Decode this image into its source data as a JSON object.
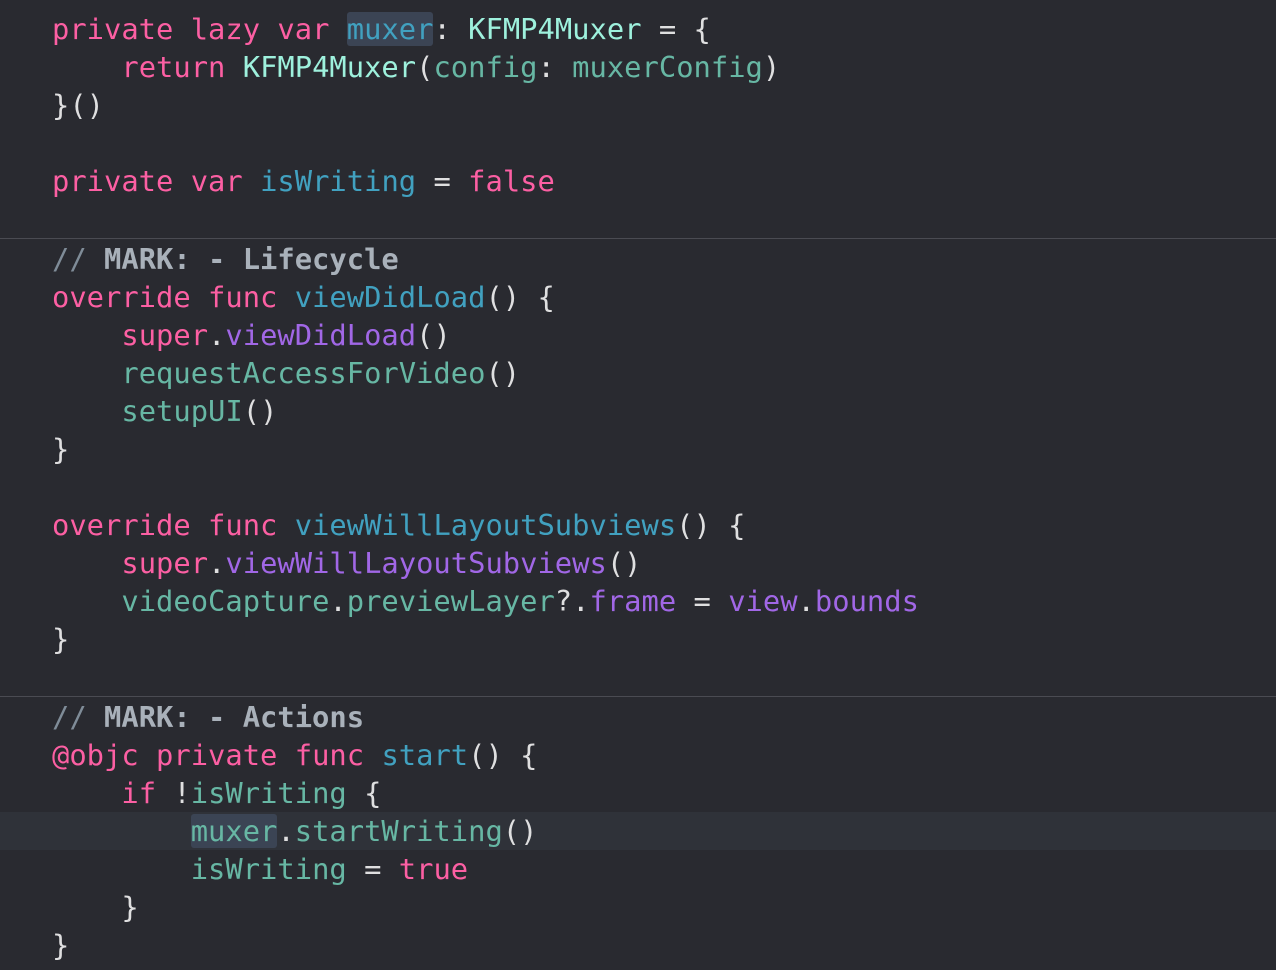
{
  "editor": {
    "lines": [
      {
        "t": 10,
        "tokens": [
          {
            "text": "private",
            "c": "kw"
          },
          {
            "text": " ",
            "c": "plain"
          },
          {
            "text": "lazy",
            "c": "kw"
          },
          {
            "text": " ",
            "c": "plain"
          },
          {
            "text": "var",
            "c": "kw"
          },
          {
            "text": " ",
            "c": "plain"
          },
          {
            "text": "muxer",
            "c": "decl",
            "hl": true
          },
          {
            "text": ": ",
            "c": "plain"
          },
          {
            "text": "KFMP4Muxer",
            "c": "type"
          },
          {
            "text": " = {",
            "c": "plain"
          }
        ]
      },
      {
        "t": 48,
        "tokens": [
          {
            "text": "    ",
            "c": "plain"
          },
          {
            "text": "return",
            "c": "kw"
          },
          {
            "text": " ",
            "c": "plain"
          },
          {
            "text": "KFMP4Muxer",
            "c": "type"
          },
          {
            "text": "(",
            "c": "plain"
          },
          {
            "text": "config",
            "c": "proj"
          },
          {
            "text": ": ",
            "c": "plain"
          },
          {
            "text": "muxerConfig",
            "c": "proj"
          },
          {
            "text": ")",
            "c": "plain"
          }
        ]
      },
      {
        "t": 86,
        "tokens": [
          {
            "text": "}()",
            "c": "plain"
          }
        ]
      },
      {
        "t": 162,
        "tokens": [
          {
            "text": "private",
            "c": "kw"
          },
          {
            "text": " ",
            "c": "plain"
          },
          {
            "text": "var",
            "c": "kw"
          },
          {
            "text": " ",
            "c": "plain"
          },
          {
            "text": "isWriting",
            "c": "decl"
          },
          {
            "text": " = ",
            "c": "plain"
          },
          {
            "text": "false",
            "c": "lit"
          }
        ]
      },
      {
        "t": 240,
        "tokens": [
          {
            "text": "// ",
            "c": "comment"
          },
          {
            "text": "MARK: - Lifecycle",
            "c": "mark"
          }
        ]
      },
      {
        "t": 278,
        "tokens": [
          {
            "text": "override",
            "c": "kw"
          },
          {
            "text": " ",
            "c": "plain"
          },
          {
            "text": "func",
            "c": "kw"
          },
          {
            "text": " ",
            "c": "plain"
          },
          {
            "text": "viewDidLoad",
            "c": "decl"
          },
          {
            "text": "() {",
            "c": "plain"
          }
        ]
      },
      {
        "t": 316,
        "tokens": [
          {
            "text": "    ",
            "c": "plain"
          },
          {
            "text": "super",
            "c": "kw"
          },
          {
            "text": ".",
            "c": "plain"
          },
          {
            "text": "viewDidLoad",
            "c": "sys"
          },
          {
            "text": "()",
            "c": "plain"
          }
        ]
      },
      {
        "t": 354,
        "tokens": [
          {
            "text": "    ",
            "c": "plain"
          },
          {
            "text": "requestAccessForVideo",
            "c": "proj"
          },
          {
            "text": "()",
            "c": "plain"
          }
        ]
      },
      {
        "t": 392,
        "tokens": [
          {
            "text": "    ",
            "c": "plain"
          },
          {
            "text": "setupUI",
            "c": "proj"
          },
          {
            "text": "()",
            "c": "plain"
          }
        ]
      },
      {
        "t": 430,
        "tokens": [
          {
            "text": "}",
            "c": "plain"
          }
        ]
      },
      {
        "t": 506,
        "tokens": [
          {
            "text": "override",
            "c": "kw"
          },
          {
            "text": " ",
            "c": "plain"
          },
          {
            "text": "func",
            "c": "kw"
          },
          {
            "text": " ",
            "c": "plain"
          },
          {
            "text": "viewWillLayoutSubviews",
            "c": "decl"
          },
          {
            "text": "() {",
            "c": "plain"
          }
        ]
      },
      {
        "t": 544,
        "tokens": [
          {
            "text": "    ",
            "c": "plain"
          },
          {
            "text": "super",
            "c": "kw"
          },
          {
            "text": ".",
            "c": "plain"
          },
          {
            "text": "viewWillLayoutSubviews",
            "c": "sys"
          },
          {
            "text": "()",
            "c": "plain"
          }
        ]
      },
      {
        "t": 582,
        "tokens": [
          {
            "text": "    ",
            "c": "plain"
          },
          {
            "text": "videoCapture",
            "c": "proj"
          },
          {
            "text": ".",
            "c": "plain"
          },
          {
            "text": "previewLayer",
            "c": "proj"
          },
          {
            "text": "?.",
            "c": "plain"
          },
          {
            "text": "frame",
            "c": "sys"
          },
          {
            "text": " = ",
            "c": "plain"
          },
          {
            "text": "view",
            "c": "sys"
          },
          {
            "text": ".",
            "c": "plain"
          },
          {
            "text": "bounds",
            "c": "sys"
          }
        ]
      },
      {
        "t": 620,
        "tokens": [
          {
            "text": "}",
            "c": "plain"
          }
        ]
      },
      {
        "t": 698,
        "tokens": [
          {
            "text": "// ",
            "c": "comment"
          },
          {
            "text": "MARK: - Actions",
            "c": "mark"
          }
        ]
      },
      {
        "t": 736,
        "tokens": [
          {
            "text": "@objc",
            "c": "kw"
          },
          {
            "text": " ",
            "c": "plain"
          },
          {
            "text": "private",
            "c": "kw"
          },
          {
            "text": " ",
            "c": "plain"
          },
          {
            "text": "func",
            "c": "kw"
          },
          {
            "text": " ",
            "c": "plain"
          },
          {
            "text": "start",
            "c": "decl"
          },
          {
            "text": "() {",
            "c": "plain"
          }
        ]
      },
      {
        "t": 774,
        "tokens": [
          {
            "text": "    ",
            "c": "plain"
          },
          {
            "text": "if",
            "c": "kw"
          },
          {
            "text": " !",
            "c": "plain"
          },
          {
            "text": "isWriting",
            "c": "proj"
          },
          {
            "text": " {",
            "c": "plain"
          }
        ]
      },
      {
        "t": 812,
        "current": true,
        "tokens": [
          {
            "text": "        ",
            "c": "plain"
          },
          {
            "text": "muxer",
            "c": "proj",
            "hl": true
          },
          {
            "text": ".",
            "c": "plain"
          },
          {
            "text": "startWriting",
            "c": "proj"
          },
          {
            "text": "()",
            "c": "plain"
          }
        ]
      },
      {
        "t": 850,
        "tokens": [
          {
            "text": "        ",
            "c": "plain"
          },
          {
            "text": "isWriting",
            "c": "proj"
          },
          {
            "text": " = ",
            "c": "plain"
          },
          {
            "text": "true",
            "c": "lit"
          }
        ]
      },
      {
        "t": 888,
        "tokens": [
          {
            "text": "    }",
            "c": "plain"
          }
        ]
      },
      {
        "t": 926,
        "tokens": [
          {
            "text": "}",
            "c": "plain"
          }
        ]
      }
    ]
  }
}
